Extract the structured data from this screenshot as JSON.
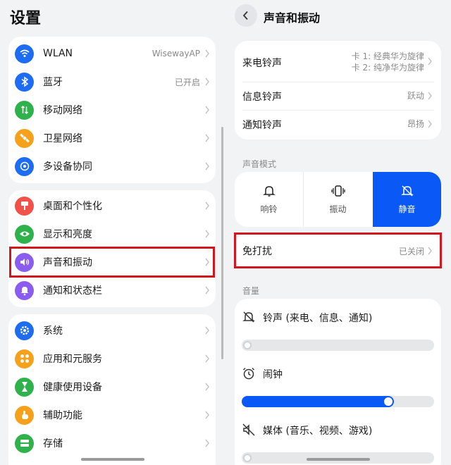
{
  "left": {
    "title": "设置",
    "group1": [
      {
        "label": "WLAN",
        "value": "WisewayAP",
        "icon": "wifi-icon",
        "color": "#1d6cf2"
      },
      {
        "label": "蓝牙",
        "value": "已开启",
        "icon": "bluetooth-icon",
        "color": "#1d6cf2"
      },
      {
        "label": "移动网络",
        "value": "",
        "icon": "mobile-network-icon",
        "color": "#2fb24c"
      },
      {
        "label": "卫星网络",
        "value": "",
        "icon": "satellite-icon",
        "color": "#f6a11c"
      },
      {
        "label": "多设备协同",
        "value": "",
        "icon": "multi-device-icon",
        "color": "#1d6cf2"
      }
    ],
    "group2": [
      {
        "label": "桌面和个性化",
        "value": "",
        "icon": "brush-icon",
        "color": "#f0524a"
      },
      {
        "label": "显示和亮度",
        "value": "",
        "icon": "eye-icon",
        "color": "#2fb24c"
      },
      {
        "label": "声音和振动",
        "value": "",
        "icon": "speaker-icon",
        "color": "#8a5cf0"
      },
      {
        "label": "通知和状态栏",
        "value": "",
        "icon": "bell-icon",
        "color": "#8a5cf0"
      }
    ],
    "group3": [
      {
        "label": "系统",
        "value": "",
        "icon": "gear-icon",
        "color": "#1d6cf2"
      },
      {
        "label": "应用和元服务",
        "value": "",
        "icon": "apps-icon",
        "color": "#f6a11c"
      },
      {
        "label": "健康使用设备",
        "value": "",
        "icon": "hourglass-icon",
        "color": "#2fb24c"
      },
      {
        "label": "辅助功能",
        "value": "",
        "icon": "hand-icon",
        "color": "#f6a11c"
      },
      {
        "label": "存储",
        "value": "",
        "icon": "storage-icon",
        "color": "#2fb24c"
      }
    ]
  },
  "right": {
    "title": "声音和振动",
    "ringtones": [
      {
        "label": "来电铃声",
        "value_line1": "卡 1: 经典华为旋律",
        "value_line2": "卡 2: 纯净华为旋律"
      },
      {
        "label": "信息铃声",
        "value_line1": "跃动",
        "value_line2": ""
      },
      {
        "label": "通知铃声",
        "value_line1": "昂扬",
        "value_line2": ""
      }
    ],
    "sound_mode_label": "声音模式",
    "modes": [
      {
        "label": "响铃",
        "icon": "bell-icon",
        "selected": false
      },
      {
        "label": "振动",
        "icon": "vibrate-icon",
        "selected": false
      },
      {
        "label": "静音",
        "icon": "bell-off-icon",
        "selected": true
      }
    ],
    "dnd": {
      "label": "免打扰",
      "value": "已关闭"
    },
    "volume_label": "音量",
    "volumes": [
      {
        "label": "铃声 (来电、信息、通知)",
        "icon": "bell-muted-icon",
        "level": 0
      },
      {
        "label": "闹钟",
        "icon": "alarm-clock-icon",
        "level": 0.79
      },
      {
        "label": "媒体 (音乐、视频、游戏)",
        "icon": "speaker-muted-icon",
        "level": 0
      }
    ]
  },
  "colors": {
    "accent": "#0a59f7",
    "highlight": "#d2161d",
    "background": "#f1f3f5"
  }
}
